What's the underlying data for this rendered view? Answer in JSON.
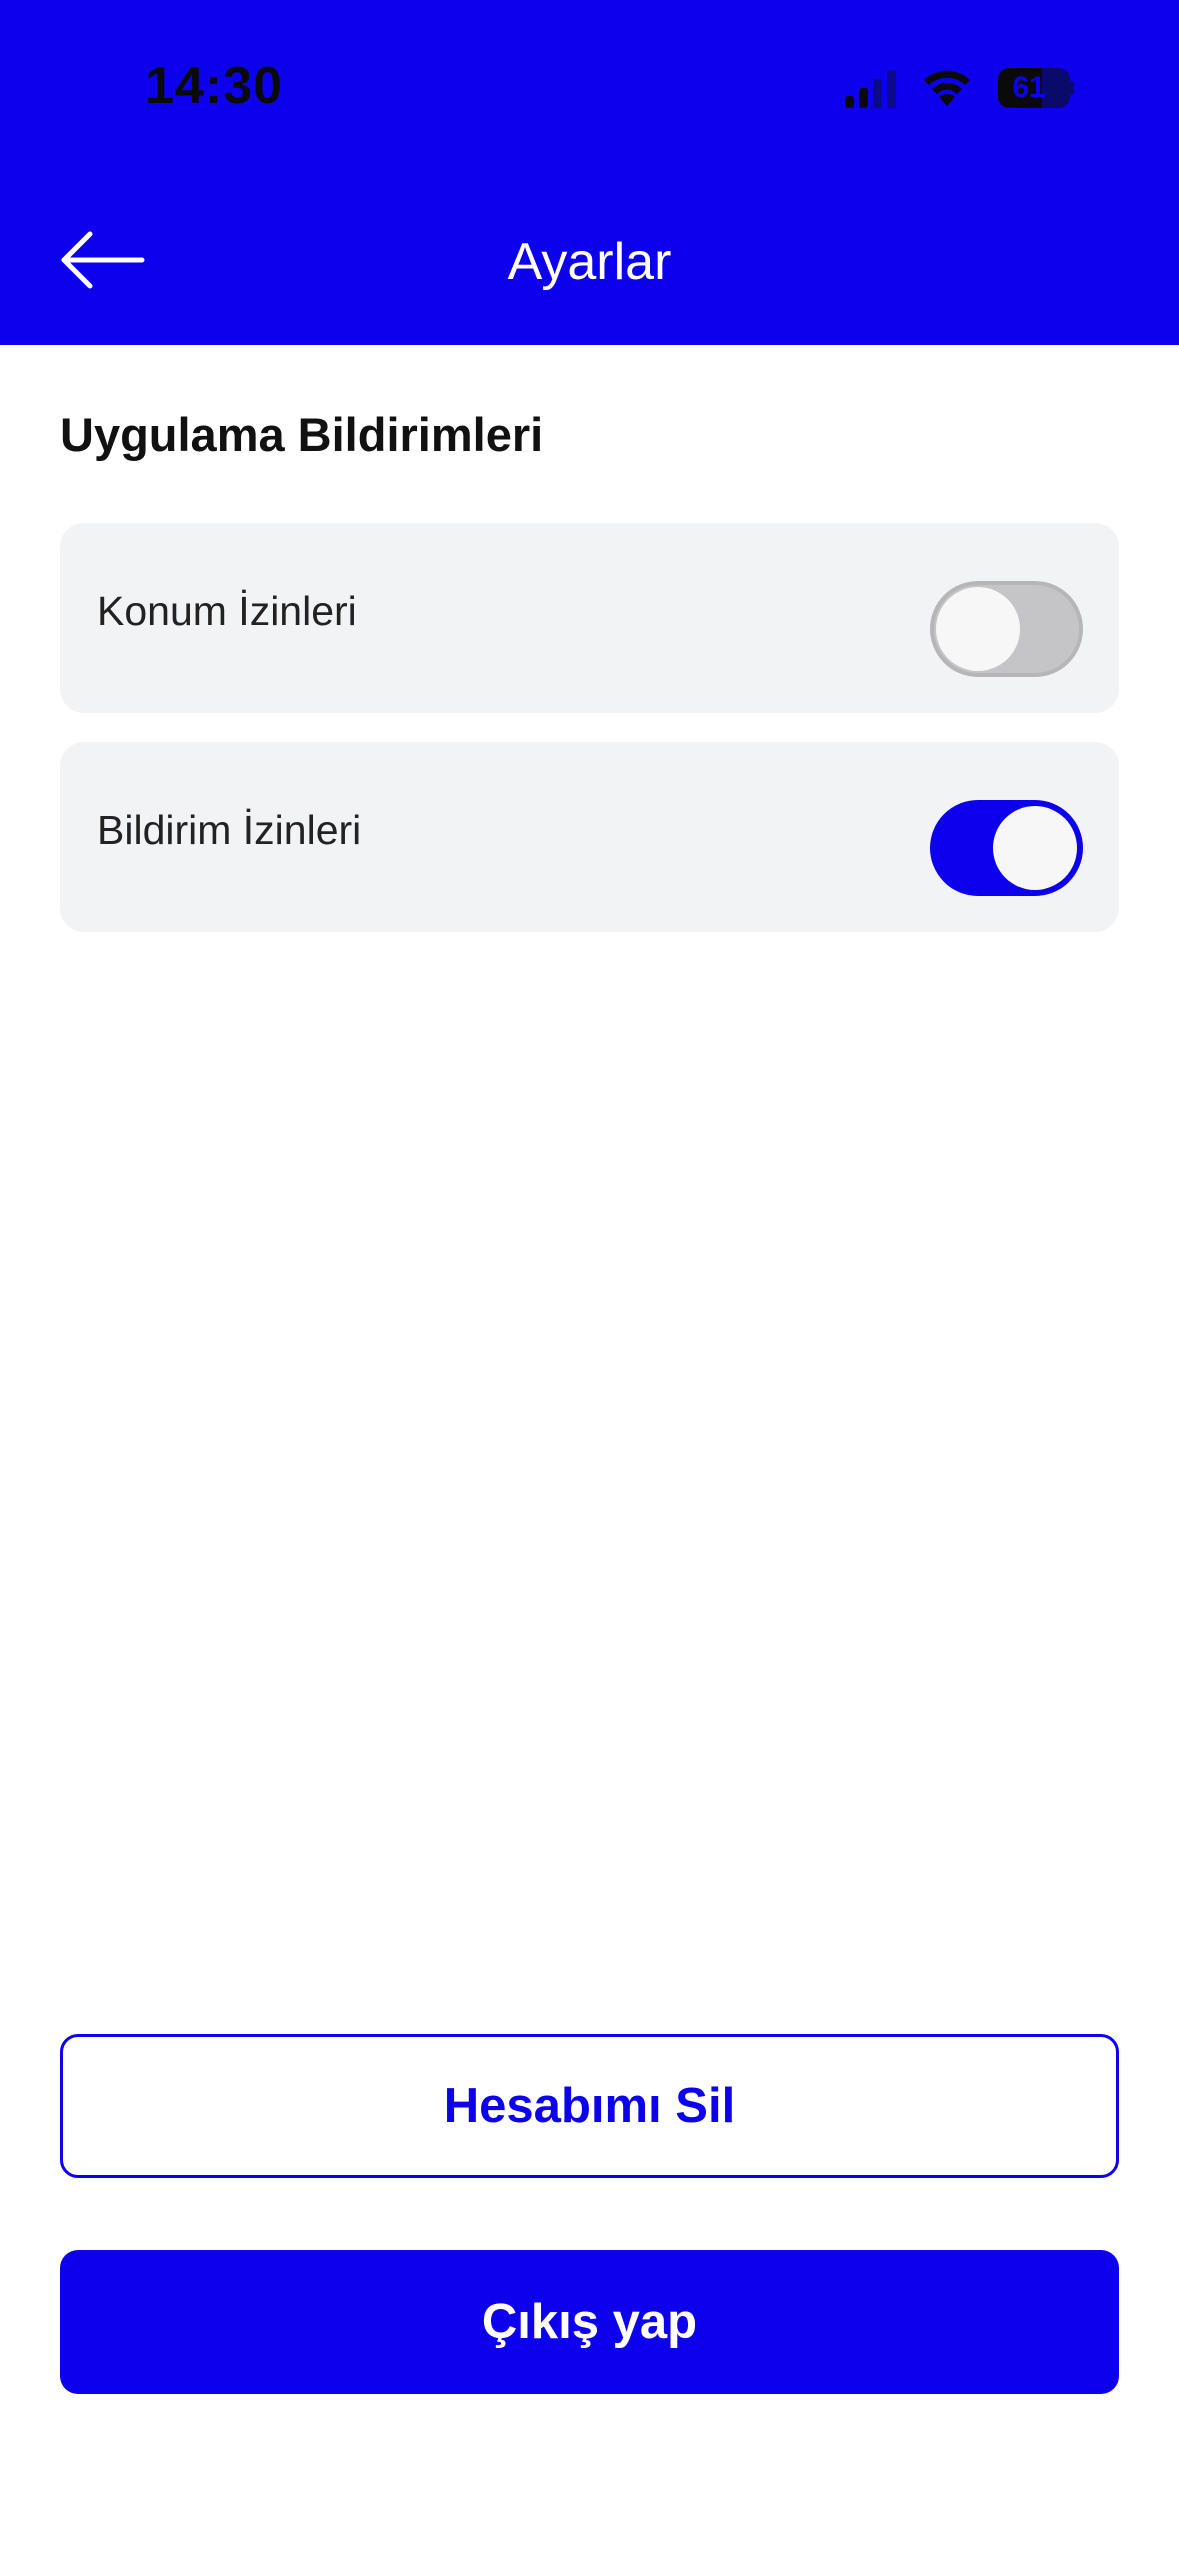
{
  "status_bar": {
    "time": "14:30",
    "battery_level": "61",
    "battery_fraction": 0.61,
    "signal_icon": "cellular-signal-icon",
    "wifi_icon": "wifi-icon"
  },
  "header": {
    "title": "Ayarlar",
    "back_icon": "arrow-left-icon"
  },
  "section": {
    "title": "Uygulama Bildirimleri"
  },
  "settings": [
    {
      "label": "Konum İzinleri",
      "enabled": false
    },
    {
      "label": "Bildirim İzinleri",
      "enabled": true
    }
  ],
  "actions": {
    "delete_account_label": "Hesabımı Sil",
    "logout_label": "Çıkış yap"
  },
  "colors": {
    "primary": "#0c00ed",
    "row_background": "#f2f3f5",
    "toggle_off": "#c5c5c7"
  }
}
